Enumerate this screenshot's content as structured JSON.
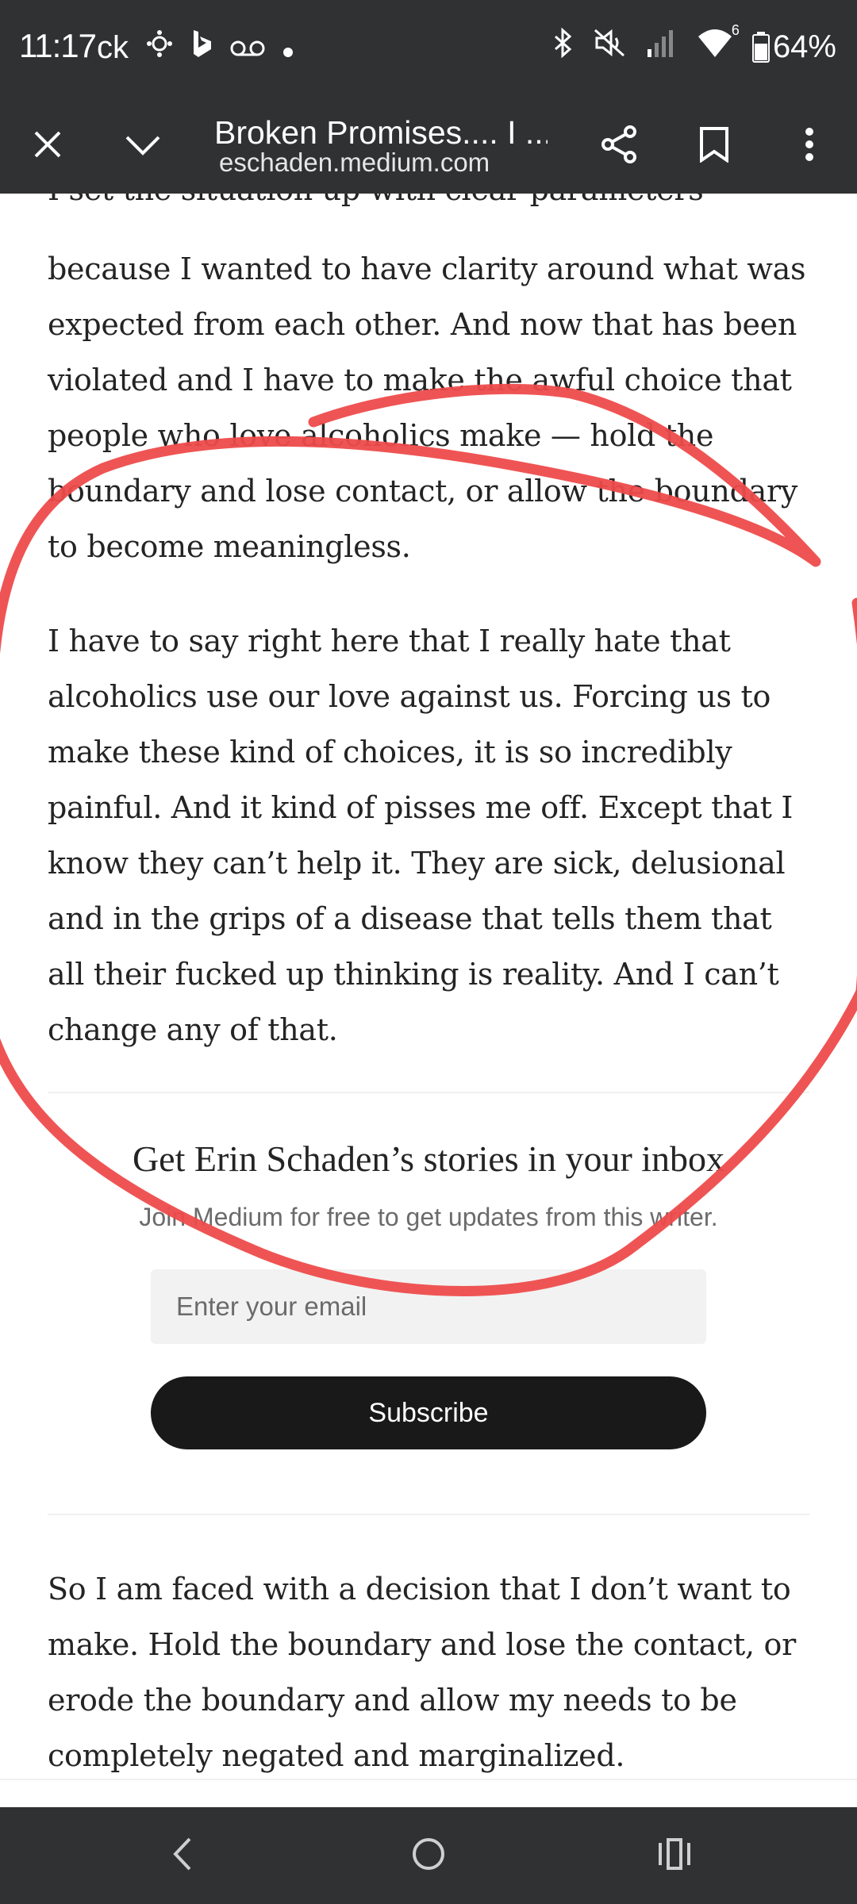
{
  "status_bar": {
    "time": "11:17",
    "left_icons": [
      "ck-icon",
      "mobile-data-icon",
      "bing-icon",
      "voicemail-icon",
      "dot-icon"
    ],
    "ck_label": "ck",
    "right_icons": [
      "bluetooth-icon",
      "mute-icon",
      "signal-icon",
      "wifi-icon",
      "battery-icon"
    ],
    "wifi_badge": "6",
    "battery": "64%"
  },
  "toolbar": {
    "title": "Broken Promises.... I ...",
    "url": "eschaden.medium.com",
    "icons": [
      "close-icon",
      "chevron-down-icon",
      "share-icon",
      "bookmark-icon",
      "more-icon"
    ]
  },
  "article": {
    "cut_line": "I set the situation up with clear parameters",
    "paragraph_1": "because I wanted to have clarity around what was expected from each other. And now that has been violated and I have to make the awful choice that people who love alcoholics make — hold the boundary and lose contact, or allow the boundary to become meaningless.",
    "paragraph_2": "I have to say right here that I really hate that alcoholics use our love against us. Forcing us to make these kind of choices, it is so incredibly painful. And it kind of pisses me off. Except that I know they can’t help it. They are sick, delusional and in the grips of a disease that tells them that all their fucked up thinking is reality. And I can’t change any of that.",
    "paragraph_3": "So I am faced with a decision that I don’t want to make. Hold the boundary and lose the contact, or erode the boundary and allow my needs to be completely negated and marginalized."
  },
  "subscribe": {
    "title": "Get Erin Schaden’s stories in your inbox",
    "subtitle": "Join Medium for free to get updates from this writer.",
    "email_placeholder": "Enter your email",
    "button_label": "Subscribe"
  },
  "nav_bar": {
    "icons": [
      "back-icon",
      "home-icon",
      "recents-icon"
    ]
  },
  "annotation": {
    "color": "#ee4b4b"
  }
}
